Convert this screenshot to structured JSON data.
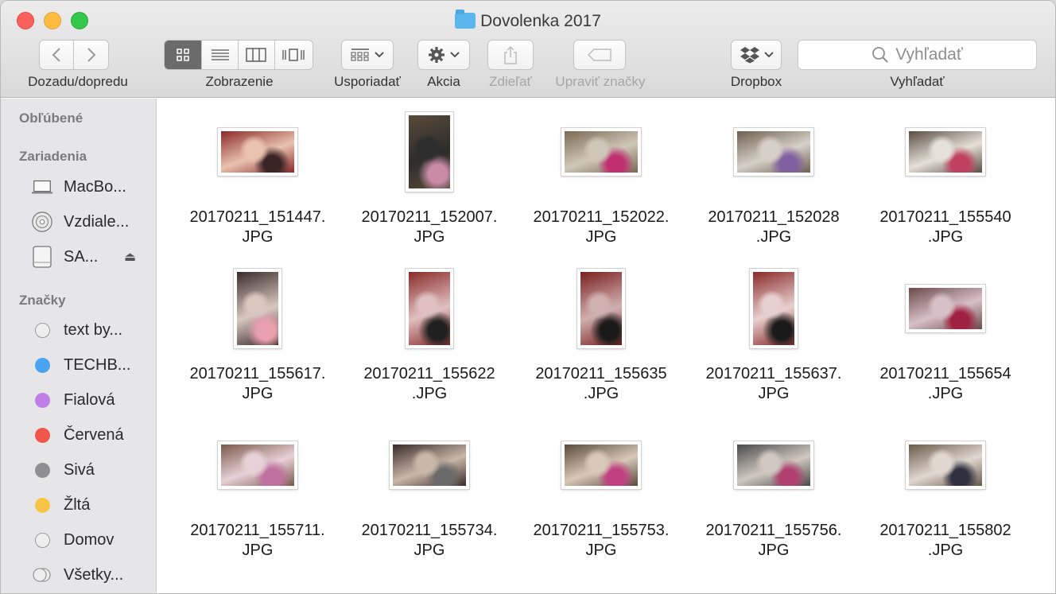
{
  "window": {
    "title": "Dovolenka 2017"
  },
  "toolbar": {
    "nav_label": "Dozadu/dopredu",
    "view_label": "Zobrazenie",
    "arrange_label": "Usporiadať",
    "action_label": "Akcia",
    "share_label": "Zdieľať",
    "tags_label": "Upraviť značky",
    "dropbox_label": "Dropbox",
    "search_label": "Vyhľadať",
    "search_placeholder": "Vyhľadať"
  },
  "sidebar": {
    "favorites_heading": "Obľúbené",
    "devices_heading": "Zariadenia",
    "devices": [
      {
        "label": "MacBo...",
        "icon": "laptop-icon"
      },
      {
        "label": "Vzdiale...",
        "icon": "disc-icon"
      },
      {
        "label": "SA...",
        "icon": "drive-icon"
      }
    ],
    "tags_heading": "Značky",
    "tags": [
      {
        "label": "text by...",
        "color": "#e5e5e5"
      },
      {
        "label": "TECHB...",
        "color": "#4aa3f0"
      },
      {
        "label": "Fialová",
        "color": "#c07fe6"
      },
      {
        "label": "Červená",
        "color": "#f0564a"
      },
      {
        "label": "Sivá",
        "color": "#8e8e93"
      },
      {
        "label": "Žltá",
        "color": "#f7c546"
      },
      {
        "label": "Domov",
        "color": "#e5e5e5"
      },
      {
        "label": "Všetky...",
        "color": "#e5e5e5"
      }
    ]
  },
  "files": [
    {
      "line1": "20170211_151447.",
      "line2": "JPG",
      "orient": "landscape",
      "colors": [
        "#8b2a2a",
        "#e9c2b0",
        "#3a2424"
      ]
    },
    {
      "line1": "20170211_152007.",
      "line2": "JPG",
      "orient": "portrait",
      "colors": [
        "#5a4a3a",
        "#2d2d2d",
        "#c98ba8"
      ]
    },
    {
      "line1": "20170211_152022.",
      "line2": "JPG",
      "orient": "landscape",
      "colors": [
        "#7a6a52",
        "#cfc7b8",
        "#c03070"
      ]
    },
    {
      "line1": "20170211_152028",
      "line2": ".JPG",
      "orient": "landscape",
      "colors": [
        "#6e6050",
        "#d7d0c8",
        "#8060a0"
      ]
    },
    {
      "line1": "20170211_155540",
      "line2": ".JPG",
      "orient": "landscape",
      "colors": [
        "#5a4e42",
        "#e6e0d8",
        "#c04060"
      ]
    },
    {
      "line1": "20170211_155617.",
      "line2": "JPG",
      "orient": "portrait",
      "colors": [
        "#3a2a2a",
        "#d8c8c0",
        "#e8a0b0"
      ]
    },
    {
      "line1": "20170211_155622",
      "line2": ".JPG",
      "orient": "portrait",
      "colors": [
        "#8a2a2a",
        "#e0c0c0",
        "#202020"
      ]
    },
    {
      "line1": "20170211_155635",
      "line2": ".JPG",
      "orient": "portrait",
      "colors": [
        "#7a2020",
        "#d0b0b0",
        "#1a1a1a"
      ]
    },
    {
      "line1": "20170211_155637.",
      "line2": "JPG",
      "orient": "portrait",
      "colors": [
        "#8a2a2a",
        "#e8d0d0",
        "#1a1a1a"
      ]
    },
    {
      "line1": "20170211_155654",
      "line2": ".JPG",
      "orient": "landscape",
      "colors": [
        "#6a4a4a",
        "#d8c0c8",
        "#a02040"
      ]
    },
    {
      "line1": "20170211_155711.",
      "line2": "JPG",
      "orient": "landscape",
      "colors": [
        "#7a5a4a",
        "#e8d0d8",
        "#c070a0"
      ]
    },
    {
      "line1": "20170211_155734.",
      "line2": "JPG",
      "orient": "landscape",
      "colors": [
        "#3a2a2a",
        "#c8b8a8",
        "#6a6a6a"
      ]
    },
    {
      "line1": "20170211_155753.",
      "line2": "JPG",
      "orient": "landscape",
      "colors": [
        "#5a4a3a",
        "#d8c8b8",
        "#c04080"
      ]
    },
    {
      "line1": "20170211_155756.",
      "line2": "JPG",
      "orient": "landscape",
      "colors": [
        "#4a4a4a",
        "#d0c8c0",
        "#b04070"
      ]
    },
    {
      "line1": "20170211_155802",
      "line2": ".JPG",
      "orient": "landscape",
      "colors": [
        "#6a5a4a",
        "#e0d8d0",
        "#303040"
      ]
    }
  ]
}
